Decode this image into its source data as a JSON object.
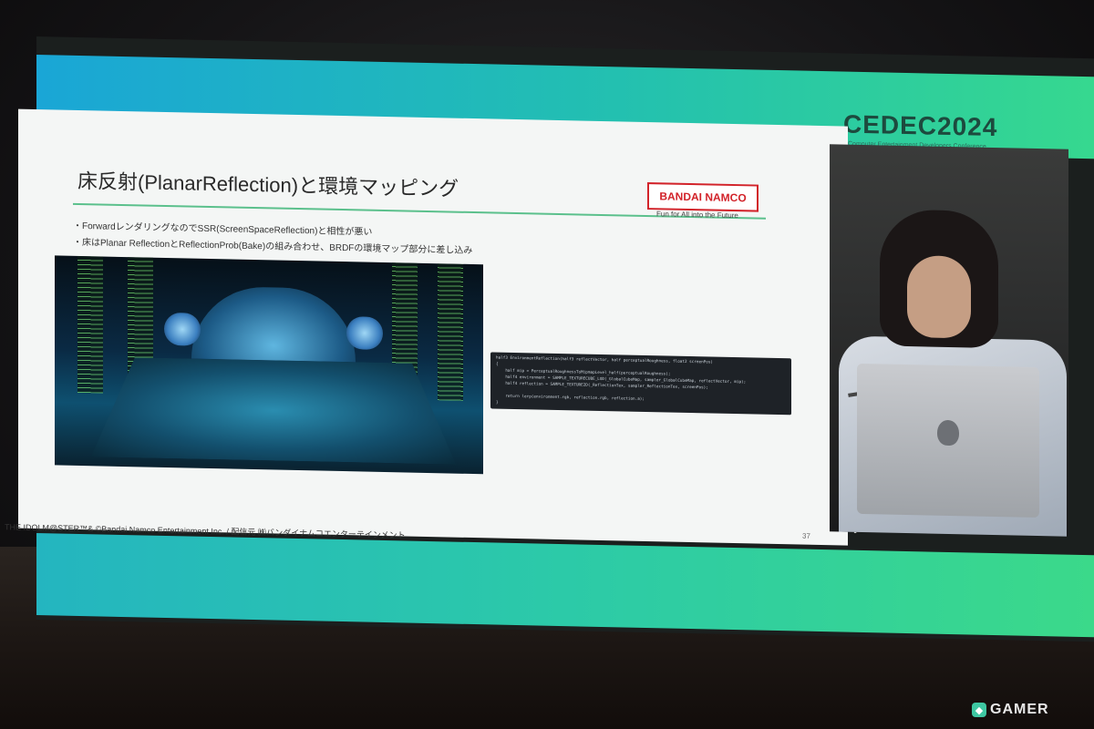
{
  "event_logo": "CEDEC2024",
  "event_logo_sub": "Computer Entertainment Developers Conference",
  "slide": {
    "title": "床反射(PlanarReflection)と環境マッピング",
    "bullets": [
      "・ForwardレンダリングなのでSSR(ScreenSpaceReflection)と相性が悪い",
      "・床はPlanar ReflectionとReflectionProb(Bake)の組み合わせ、BRDFの環境マップ部分に差し込み"
    ],
    "company_logo": "BANDAI NAMCO",
    "company_tagline": "Fun for All into the Future",
    "code_lines": [
      "half3 EnvironmentReflection(half3 reflectVector, half perceptualRoughness, float2 screenPos)",
      "{",
      "    half mip = PerceptualRoughnessToMipmapLevel_half(perceptualRoughness);",
      "    half4 environment = SAMPLE_TEXTURECUBE_LOD(_GlobalCubeMap, sampler_GlobalCubeMap, reflectVector, mip);",
      "    half4 reflection = SAMPLE_TEXTURE2D(_ReflectionTex, sampler_ReflectionTex, screenPos);",
      "",
      "    return lerp(environment.rgb, reflection.rgb, reflection.a);",
      "}"
    ],
    "footer": "THE IDOLM@STER™& ©Bandai Namco Entertainment Inc. / 配信元 ㈱バンダイナムコエンターテインメント",
    "page_number": "37"
  },
  "watermark": "GAMER",
  "colors": {
    "band_start": "#1aa6d6",
    "band_end": "#36d88f",
    "accent_rule": "#5bc08c",
    "brand_red": "#d2232a"
  }
}
